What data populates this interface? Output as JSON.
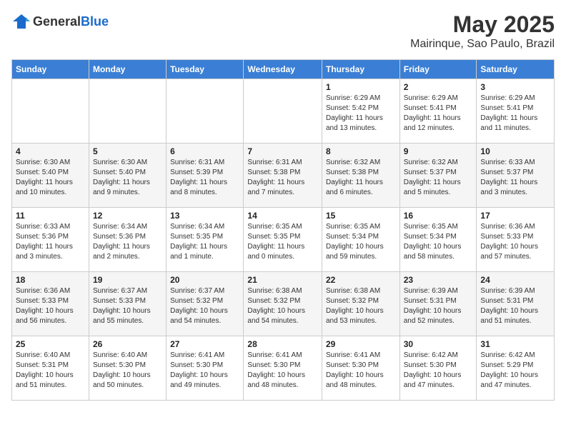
{
  "header": {
    "logo_general": "General",
    "logo_blue": "Blue",
    "month": "May 2025",
    "location": "Mairinque, Sao Paulo, Brazil"
  },
  "weekdays": [
    "Sunday",
    "Monday",
    "Tuesday",
    "Wednesday",
    "Thursday",
    "Friday",
    "Saturday"
  ],
  "weeks": [
    [
      {
        "day": "",
        "info": ""
      },
      {
        "day": "",
        "info": ""
      },
      {
        "day": "",
        "info": ""
      },
      {
        "day": "",
        "info": ""
      },
      {
        "day": "1",
        "info": "Sunrise: 6:29 AM\nSunset: 5:42 PM\nDaylight: 11 hours and 13 minutes."
      },
      {
        "day": "2",
        "info": "Sunrise: 6:29 AM\nSunset: 5:41 PM\nDaylight: 11 hours and 12 minutes."
      },
      {
        "day": "3",
        "info": "Sunrise: 6:29 AM\nSunset: 5:41 PM\nDaylight: 11 hours and 11 minutes."
      }
    ],
    [
      {
        "day": "4",
        "info": "Sunrise: 6:30 AM\nSunset: 5:40 PM\nDaylight: 11 hours and 10 minutes."
      },
      {
        "day": "5",
        "info": "Sunrise: 6:30 AM\nSunset: 5:40 PM\nDaylight: 11 hours and 9 minutes."
      },
      {
        "day": "6",
        "info": "Sunrise: 6:31 AM\nSunset: 5:39 PM\nDaylight: 11 hours and 8 minutes."
      },
      {
        "day": "7",
        "info": "Sunrise: 6:31 AM\nSunset: 5:38 PM\nDaylight: 11 hours and 7 minutes."
      },
      {
        "day": "8",
        "info": "Sunrise: 6:32 AM\nSunset: 5:38 PM\nDaylight: 11 hours and 6 minutes."
      },
      {
        "day": "9",
        "info": "Sunrise: 6:32 AM\nSunset: 5:37 PM\nDaylight: 11 hours and 5 minutes."
      },
      {
        "day": "10",
        "info": "Sunrise: 6:33 AM\nSunset: 5:37 PM\nDaylight: 11 hours and 3 minutes."
      }
    ],
    [
      {
        "day": "11",
        "info": "Sunrise: 6:33 AM\nSunset: 5:36 PM\nDaylight: 11 hours and 3 minutes."
      },
      {
        "day": "12",
        "info": "Sunrise: 6:34 AM\nSunset: 5:36 PM\nDaylight: 11 hours and 2 minutes."
      },
      {
        "day": "13",
        "info": "Sunrise: 6:34 AM\nSunset: 5:35 PM\nDaylight: 11 hours and 1 minute."
      },
      {
        "day": "14",
        "info": "Sunrise: 6:35 AM\nSunset: 5:35 PM\nDaylight: 11 hours and 0 minutes."
      },
      {
        "day": "15",
        "info": "Sunrise: 6:35 AM\nSunset: 5:34 PM\nDaylight: 10 hours and 59 minutes."
      },
      {
        "day": "16",
        "info": "Sunrise: 6:35 AM\nSunset: 5:34 PM\nDaylight: 10 hours and 58 minutes."
      },
      {
        "day": "17",
        "info": "Sunrise: 6:36 AM\nSunset: 5:33 PM\nDaylight: 10 hours and 57 minutes."
      }
    ],
    [
      {
        "day": "18",
        "info": "Sunrise: 6:36 AM\nSunset: 5:33 PM\nDaylight: 10 hours and 56 minutes."
      },
      {
        "day": "19",
        "info": "Sunrise: 6:37 AM\nSunset: 5:33 PM\nDaylight: 10 hours and 55 minutes."
      },
      {
        "day": "20",
        "info": "Sunrise: 6:37 AM\nSunset: 5:32 PM\nDaylight: 10 hours and 54 minutes."
      },
      {
        "day": "21",
        "info": "Sunrise: 6:38 AM\nSunset: 5:32 PM\nDaylight: 10 hours and 54 minutes."
      },
      {
        "day": "22",
        "info": "Sunrise: 6:38 AM\nSunset: 5:32 PM\nDaylight: 10 hours and 53 minutes."
      },
      {
        "day": "23",
        "info": "Sunrise: 6:39 AM\nSunset: 5:31 PM\nDaylight: 10 hours and 52 minutes."
      },
      {
        "day": "24",
        "info": "Sunrise: 6:39 AM\nSunset: 5:31 PM\nDaylight: 10 hours and 51 minutes."
      }
    ],
    [
      {
        "day": "25",
        "info": "Sunrise: 6:40 AM\nSunset: 5:31 PM\nDaylight: 10 hours and 51 minutes."
      },
      {
        "day": "26",
        "info": "Sunrise: 6:40 AM\nSunset: 5:30 PM\nDaylight: 10 hours and 50 minutes."
      },
      {
        "day": "27",
        "info": "Sunrise: 6:41 AM\nSunset: 5:30 PM\nDaylight: 10 hours and 49 minutes."
      },
      {
        "day": "28",
        "info": "Sunrise: 6:41 AM\nSunset: 5:30 PM\nDaylight: 10 hours and 48 minutes."
      },
      {
        "day": "29",
        "info": "Sunrise: 6:41 AM\nSunset: 5:30 PM\nDaylight: 10 hours and 48 minutes."
      },
      {
        "day": "30",
        "info": "Sunrise: 6:42 AM\nSunset: 5:30 PM\nDaylight: 10 hours and 47 minutes."
      },
      {
        "day": "31",
        "info": "Sunrise: 6:42 AM\nSunset: 5:29 PM\nDaylight: 10 hours and 47 minutes."
      }
    ]
  ]
}
